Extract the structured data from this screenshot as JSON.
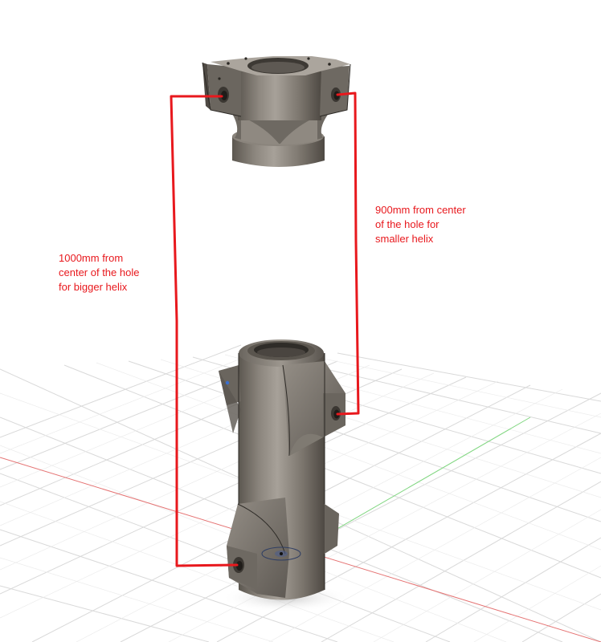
{
  "annotations": {
    "smaller_helix": {
      "lines": [
        "900mm from center",
        "of the hole for",
        "smaller helix"
      ],
      "distance": "900mm"
    },
    "bigger_helix": {
      "lines": [
        "1000mm from",
        "center of the hole",
        "for bigger helix"
      ],
      "distance": "1000mm"
    }
  },
  "colors": {
    "annotation": "#e8181d",
    "part_body": "#7d776f",
    "part_light": "#a39d95",
    "part_dark": "#4f4a44",
    "grid": "#d5d5d5",
    "x_axis": "#e06a6a",
    "y_axis": "#7fd27f"
  }
}
